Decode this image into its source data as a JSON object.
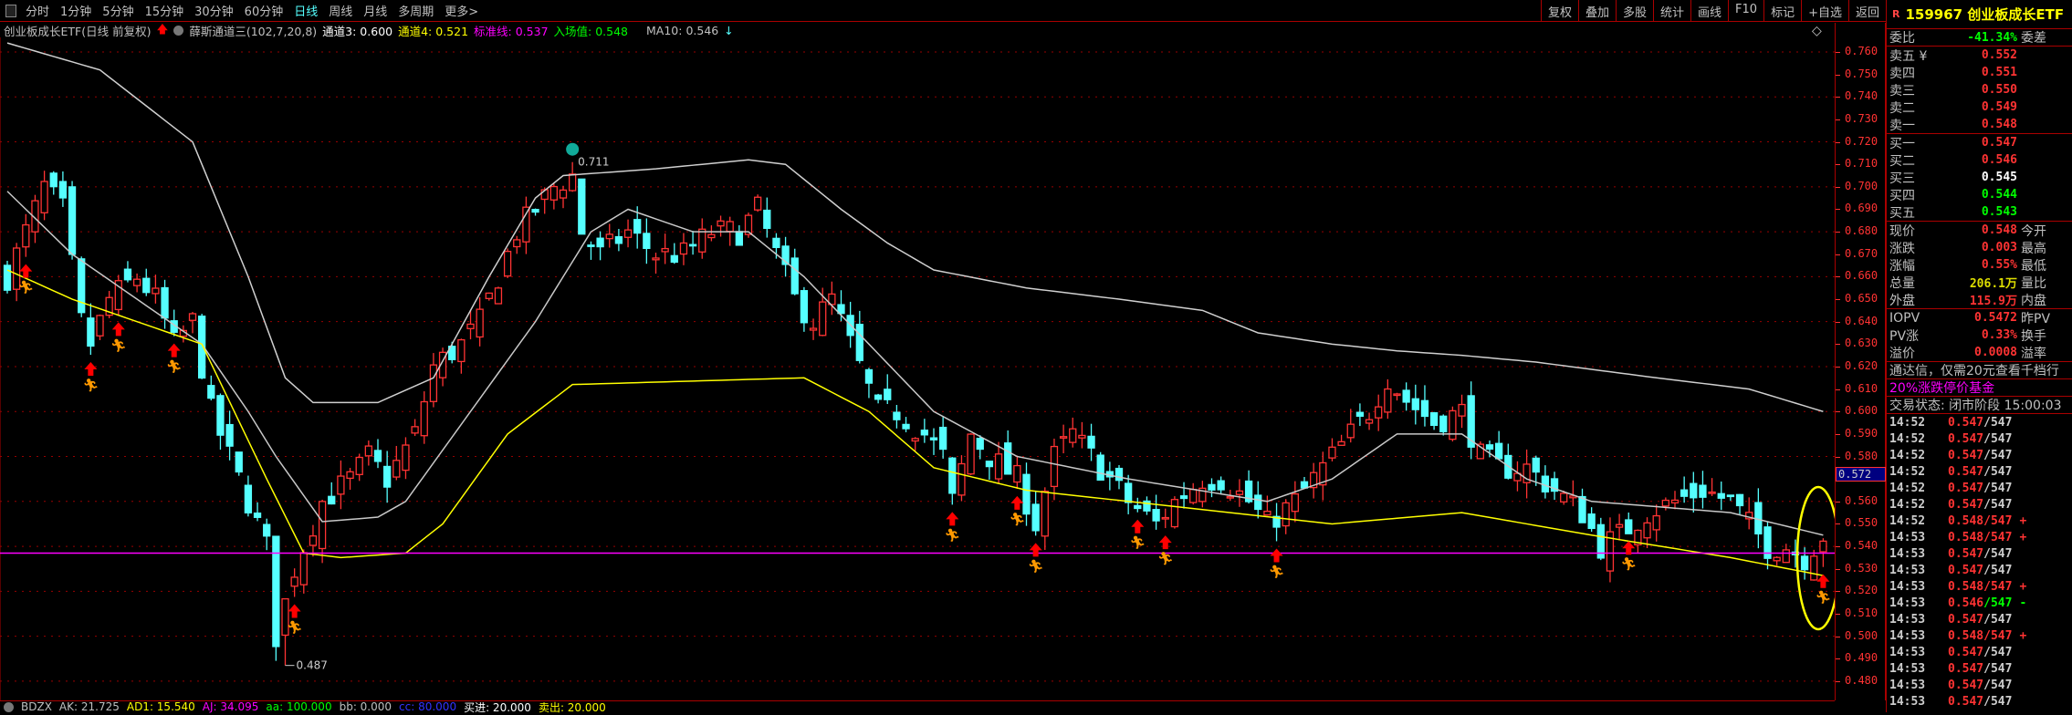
{
  "toolbar": {
    "tabs": [
      "分时",
      "1分钟",
      "5分钟",
      "15分钟",
      "30分钟",
      "60分钟",
      "日线",
      "周线",
      "月线",
      "多周期",
      "更多>"
    ],
    "active": 6,
    "buttons": [
      "复权",
      "叠加",
      "多股",
      "统计",
      "画线",
      "F10",
      "标记",
      "+自选",
      "返回"
    ]
  },
  "info": {
    "title": "创业板成长ETF(日线 前复权)",
    "indicator": "薛斯通道三(102,7,20,8)",
    "ch3": "通道3: 0.600",
    "ch4": "通道4: 0.521",
    "std": "标准线: 0.537",
    "entry": "入场值: 0.548",
    "ma10": "MA10: 0.546"
  },
  "bottom": {
    "name": "BDZX",
    "ak": "AK: 21.725",
    "ad1": "AD1: 15.540",
    "aj": "AJ: 34.095",
    "aa": "aa: 100.000",
    "bb": "bb: 0.000",
    "cc": "cc: 80.000",
    "buy": "买进: 20.000",
    "sell": "卖出: 20.000"
  },
  "panel": {
    "badge": "R",
    "code": "159967",
    "name": "创业板成长ETF",
    "weibi": {
      "k": "委比",
      "v": "-41.34%",
      "k2": "委差"
    },
    "sell": [
      {
        "k": "卖五",
        "v": "0.552",
        "sym": "¥"
      },
      {
        "k": "卖四",
        "v": "0.551"
      },
      {
        "k": "卖三",
        "v": "0.550"
      },
      {
        "k": "卖二",
        "v": "0.549"
      },
      {
        "k": "卖一",
        "v": "0.548"
      }
    ],
    "buy": [
      {
        "k": "买一",
        "v": "0.547",
        "c": "red"
      },
      {
        "k": "买二",
        "v": "0.546",
        "c": "red"
      },
      {
        "k": "买三",
        "v": "0.545",
        "c": "wht"
      },
      {
        "k": "买四",
        "v": "0.544",
        "c": "grn"
      },
      {
        "k": "买五",
        "v": "0.543",
        "c": "grn"
      }
    ],
    "quote": [
      {
        "k": "现价",
        "v": "0.548",
        "k2": "今开",
        "c": "red"
      },
      {
        "k": "涨跌",
        "v": "0.003",
        "k2": "最高",
        "c": "red"
      },
      {
        "k": "涨幅",
        "v": "0.55%",
        "k2": "最低",
        "c": "red"
      },
      {
        "k": "总量",
        "v": "206.1万",
        "k2": "量比",
        "c": "yel"
      },
      {
        "k": "外盘",
        "v": "115.9万",
        "k2": "内盘",
        "c": "red"
      }
    ],
    "iopv": [
      {
        "k": "IOPV",
        "v": "0.5472",
        "k2": "昨PV"
      },
      {
        "k": "PV涨",
        "v": "0.33%",
        "k2": "换手"
      },
      {
        "k": "溢价",
        "v": "0.0008",
        "k2": "溢率"
      }
    ],
    "ad": "通达信，仅需20元查看千档行",
    "fund": "20%涨跌停价基金",
    "status": "交易状态: 闭市阶段 15:00:03",
    "ticks": [
      [
        "14:52",
        "0.547",
        "/547",
        ""
      ],
      [
        "14:52",
        "0.547",
        "/547",
        ""
      ],
      [
        "14:52",
        "0.547",
        "/547",
        ""
      ],
      [
        "14:52",
        "0.547",
        "/547",
        ""
      ],
      [
        "14:52",
        "0.547",
        "/547",
        ""
      ],
      [
        "14:52",
        "0.547",
        "/547",
        ""
      ],
      [
        "14:52",
        "0.548",
        "/547",
        "+"
      ],
      [
        "14:53",
        "0.548",
        "/547",
        "+"
      ],
      [
        "14:53",
        "0.547",
        "/547",
        ""
      ],
      [
        "14:53",
        "0.547",
        "/547",
        ""
      ],
      [
        "14:53",
        "0.548",
        "/547",
        "+"
      ],
      [
        "14:53",
        "0.546",
        "/547",
        "-"
      ],
      [
        "14:53",
        "0.547",
        "/547",
        ""
      ],
      [
        "14:53",
        "0.548",
        "/547",
        "+"
      ],
      [
        "14:53",
        "0.547",
        "/547",
        ""
      ],
      [
        "14:53",
        "0.547",
        "/547",
        ""
      ],
      [
        "14:53",
        "0.547",
        "/547",
        ""
      ],
      [
        "14:53",
        "0.547",
        "/547",
        ""
      ]
    ]
  },
  "colors": {
    "up": "#ff3333",
    "down": "#55ffff",
    "upper": "#d0d0d0",
    "mid": "#c8c8c8",
    "ch4": "#ffff00",
    "std": "#ff00ff"
  },
  "chart_data": {
    "type": "candlestick",
    "ylim": [
      0.475,
      0.765
    ],
    "yticks": [
      0.76,
      0.75,
      0.74,
      0.73,
      0.72,
      0.71,
      0.7,
      0.69,
      0.68,
      0.67,
      0.66,
      0.65,
      0.64,
      0.63,
      0.62,
      0.61,
      0.6,
      0.59,
      0.58,
      0.57,
      0.56,
      0.55,
      0.54,
      0.53,
      0.52,
      0.51,
      0.5,
      0.49,
      0.48
    ],
    "bars": 197,
    "current_label": "0.572",
    "current_value": 0.572,
    "high_label": "0.711",
    "high": [
      61,
      0.711
    ],
    "low_label": "0.487",
    "low": [
      30,
      0.487
    ],
    "close_keypoints": [
      [
        0,
        0.66
      ],
      [
        2,
        0.68
      ],
      [
        4,
        0.7
      ],
      [
        6,
        0.69
      ],
      [
        8,
        0.64
      ],
      [
        9,
        0.63
      ],
      [
        11,
        0.65
      ],
      [
        14,
        0.66
      ],
      [
        16,
        0.65
      ],
      [
        18,
        0.63
      ],
      [
        20,
        0.64
      ],
      [
        22,
        0.6
      ],
      [
        24,
        0.58
      ],
      [
        26,
        0.56
      ],
      [
        28,
        0.54
      ],
      [
        29,
        0.5
      ],
      [
        31,
        0.53
      ],
      [
        32,
        0.54
      ],
      [
        34,
        0.56
      ],
      [
        37,
        0.57
      ],
      [
        39,
        0.58
      ],
      [
        41,
        0.57
      ],
      [
        44,
        0.59
      ],
      [
        46,
        0.62
      ],
      [
        49,
        0.63
      ],
      [
        51,
        0.64
      ],
      [
        53,
        0.66
      ],
      [
        55,
        0.68
      ],
      [
        57,
        0.69
      ],
      [
        59,
        0.7
      ],
      [
        61,
        0.705
      ],
      [
        62,
        0.68
      ],
      [
        64,
        0.67
      ],
      [
        67,
        0.68
      ],
      [
        70,
        0.67
      ],
      [
        73,
        0.67
      ],
      [
        76,
        0.68
      ],
      [
        79,
        0.68
      ],
      [
        81,
        0.69
      ],
      [
        83,
        0.67
      ],
      [
        85,
        0.65
      ],
      [
        87,
        0.64
      ],
      [
        89,
        0.65
      ],
      [
        91,
        0.63
      ],
      [
        94,
        0.6
      ],
      [
        96,
        0.6
      ],
      [
        99,
        0.59
      ],
      [
        101,
        0.58
      ],
      [
        102,
        0.56
      ],
      [
        104,
        0.59
      ],
      [
        106,
        0.58
      ],
      [
        109,
        0.57
      ],
      [
        111,
        0.55
      ],
      [
        113,
        0.58
      ],
      [
        115,
        0.59
      ],
      [
        117,
        0.58
      ],
      [
        119,
        0.57
      ],
      [
        121,
        0.56
      ],
      [
        124,
        0.55
      ],
      [
        126,
        0.56
      ],
      [
        129,
        0.57
      ],
      [
        131,
        0.57
      ],
      [
        134,
        0.56
      ],
      [
        136,
        0.55
      ],
      [
        139,
        0.56
      ],
      [
        141,
        0.57
      ],
      [
        143,
        0.58
      ],
      [
        145,
        0.59
      ],
      [
        147,
        0.6
      ],
      [
        149,
        0.615
      ],
      [
        151,
        0.605
      ],
      [
        154,
        0.595
      ],
      [
        157,
        0.6
      ],
      [
        159,
        0.58
      ],
      [
        161,
        0.575
      ],
      [
        164,
        0.575
      ],
      [
        167,
        0.565
      ],
      [
        170,
        0.555
      ],
      [
        172,
        0.54
      ],
      [
        174,
        0.545
      ],
      [
        177,
        0.555
      ],
      [
        180,
        0.56
      ],
      [
        183,
        0.565
      ],
      [
        186,
        0.56
      ],
      [
        188,
        0.55
      ],
      [
        190,
        0.54
      ],
      [
        192,
        0.54
      ],
      [
        194,
        0.535
      ],
      [
        196,
        0.545
      ]
    ],
    "upper_band": [
      [
        0,
        0.764
      ],
      [
        10,
        0.752
      ],
      [
        20,
        0.72
      ],
      [
        26,
        0.66
      ],
      [
        30,
        0.615
      ],
      [
        33,
        0.604
      ],
      [
        40,
        0.604
      ],
      [
        46,
        0.615
      ],
      [
        52,
        0.66
      ],
      [
        57,
        0.695
      ],
      [
        60,
        0.705
      ],
      [
        70,
        0.708
      ],
      [
        80,
        0.712
      ],
      [
        84,
        0.71
      ],
      [
        90,
        0.69
      ],
      [
        95,
        0.675
      ],
      [
        100,
        0.663
      ],
      [
        110,
        0.655
      ],
      [
        120,
        0.65
      ],
      [
        129,
        0.645
      ],
      [
        135,
        0.635
      ],
      [
        143,
        0.63
      ],
      [
        150,
        0.627
      ],
      [
        157,
        0.625
      ],
      [
        165,
        0.622
      ],
      [
        178,
        0.615
      ],
      [
        188,
        0.61
      ],
      [
        196,
        0.6
      ]
    ],
    "mid_line": [
      [
        0,
        0.698
      ],
      [
        7,
        0.67
      ],
      [
        14,
        0.65
      ],
      [
        21,
        0.63
      ],
      [
        26,
        0.6
      ],
      [
        29,
        0.58
      ],
      [
        34,
        0.551
      ],
      [
        40,
        0.553
      ],
      [
        43,
        0.56
      ],
      [
        50,
        0.6
      ],
      [
        57,
        0.64
      ],
      [
        63,
        0.68
      ],
      [
        67,
        0.69
      ],
      [
        74,
        0.68
      ],
      [
        80,
        0.68
      ],
      [
        86,
        0.66
      ],
      [
        93,
        0.63
      ],
      [
        100,
        0.6
      ],
      [
        109,
        0.58
      ],
      [
        121,
        0.57
      ],
      [
        136,
        0.56
      ],
      [
        143,
        0.57
      ],
      [
        150,
        0.59
      ],
      [
        157,
        0.59
      ],
      [
        164,
        0.57
      ],
      [
        171,
        0.56
      ],
      [
        186,
        0.555
      ],
      [
        196,
        0.545
      ]
    ],
    "channel4": [
      [
        0,
        0.663
      ],
      [
        7,
        0.65
      ],
      [
        14,
        0.64
      ],
      [
        21,
        0.63
      ],
      [
        28,
        0.57
      ],
      [
        32,
        0.537
      ],
      [
        36,
        0.535
      ],
      [
        43,
        0.537
      ],
      [
        47,
        0.55
      ],
      [
        54,
        0.59
      ],
      [
        61,
        0.612
      ],
      [
        86,
        0.615
      ],
      [
        93,
        0.6
      ],
      [
        100,
        0.575
      ],
      [
        110,
        0.565
      ],
      [
        121,
        0.56
      ],
      [
        143,
        0.55
      ],
      [
        157,
        0.555
      ],
      [
        171,
        0.545
      ],
      [
        186,
        0.535
      ],
      [
        196,
        0.527
      ]
    ],
    "std_line": 0.537,
    "signals": [
      2,
      9,
      12,
      18,
      31,
      102,
      109,
      111,
      122,
      125,
      137,
      175,
      196
    ]
  }
}
